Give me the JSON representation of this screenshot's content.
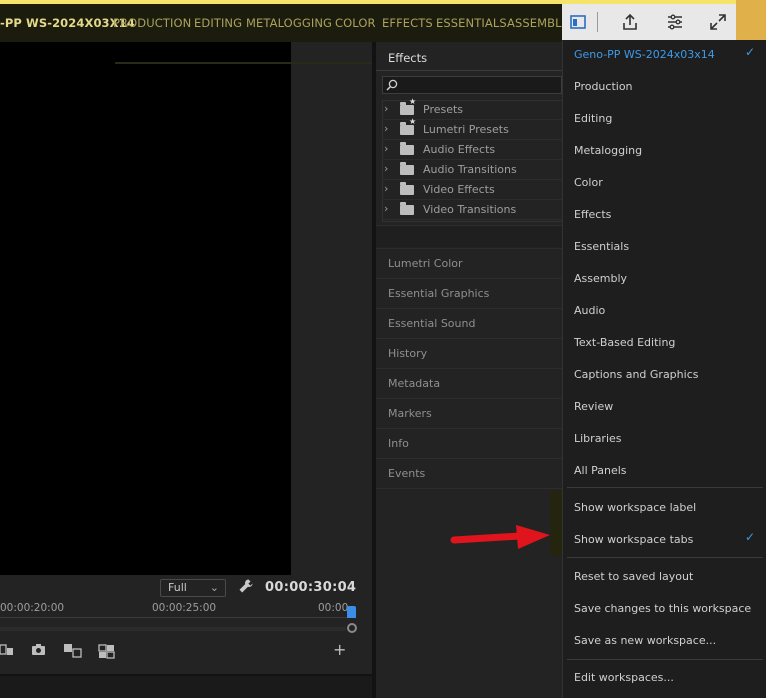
{
  "workspace_bar": {
    "tabs": [
      {
        "label": "-PP WS-2024X03X14",
        "active": true
      },
      {
        "label": "PRODUCTION",
        "active": false
      },
      {
        "label": "EDITING",
        "active": false
      },
      {
        "label": "METALOGGING",
        "active": false
      },
      {
        "label": "COLOR",
        "active": false
      },
      {
        "label": "EFFECTS",
        "active": false
      },
      {
        "label": "ESSENTIALS",
        "active": false
      },
      {
        "label": "ASSEMBL",
        "active": false
      }
    ]
  },
  "header_icons": [
    "workspaces-panel-icon",
    "share-export-icon",
    "quick-export-icon",
    "fullscreen-icon"
  ],
  "monitor": {
    "zoom_select": "Full",
    "timecode": "00:00:30:04",
    "ruler_labels": [
      "00:00:20:00",
      "00:00:25:00",
      "00:00"
    ],
    "add_button": "+"
  },
  "effects_panel": {
    "title": "Effects",
    "search_placeholder": "",
    "tree": [
      {
        "label": "Presets",
        "starred": true
      },
      {
        "label": "Lumetri Presets",
        "starred": true
      },
      {
        "label": "Audio Effects",
        "starred": false
      },
      {
        "label": "Audio Transitions",
        "starred": false
      },
      {
        "label": "Video Effects",
        "starred": false
      },
      {
        "label": "Video Transitions",
        "starred": false
      }
    ],
    "panels": [
      "Lumetri Color",
      "Essential Graphics",
      "Essential Sound",
      "History",
      "Metadata",
      "Markers",
      "Info",
      "Events"
    ]
  },
  "workspace_menu": {
    "items": [
      {
        "label": "Geno-PP WS-2024x03x14",
        "checked": true,
        "current": true
      },
      {
        "label": "Production"
      },
      {
        "label": "Editing"
      },
      {
        "label": "Metalogging"
      },
      {
        "label": "Color"
      },
      {
        "label": "Effects"
      },
      {
        "label": "Essentials"
      },
      {
        "label": "Assembly"
      },
      {
        "label": "Audio"
      },
      {
        "label": "Text-Based Editing"
      },
      {
        "label": "Captions and Graphics"
      },
      {
        "label": "Review"
      },
      {
        "label": "Libraries"
      },
      {
        "label": "All Panels"
      }
    ],
    "options": [
      {
        "label": "Show workspace label",
        "checked": false
      },
      {
        "label": "Show workspace tabs",
        "checked": true
      }
    ],
    "actions": [
      "Reset to saved layout",
      "Save changes to this workspace",
      "Save as new workspace...",
      "Edit workspaces..."
    ]
  },
  "colors": {
    "accent": "#3e9ae8",
    "workspace_tab": "#a9a35c",
    "arrow": "#e0141c"
  }
}
